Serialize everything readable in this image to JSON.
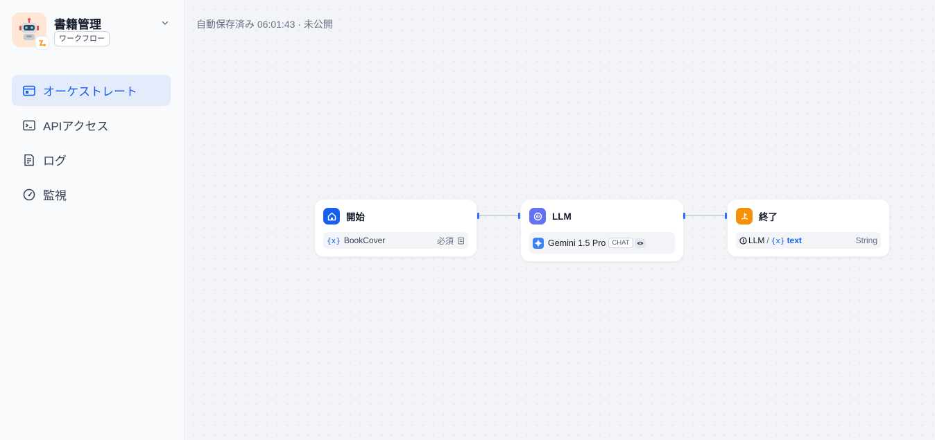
{
  "app": {
    "title": "書籍管理",
    "tag": "ワークフロー"
  },
  "nav": [
    {
      "label": "オーケストレート",
      "icon": "window-icon",
      "active": true
    },
    {
      "label": "APIアクセス",
      "icon": "terminal-icon",
      "active": false
    },
    {
      "label": "ログ",
      "icon": "log-icon",
      "active": false
    },
    {
      "label": "監視",
      "icon": "gauge-icon",
      "active": false
    }
  ],
  "canvas": {
    "status": "自動保存済み 06:01:43 · 未公開"
  },
  "nodes": {
    "start": {
      "title": "開始",
      "var_symbol": "{x}",
      "var_name": "BookCover",
      "required": "必須",
      "color": "#155eef"
    },
    "llm": {
      "title": "LLM",
      "model": "Gemini 1.5 Pro",
      "mode": "CHAT",
      "color": "#6172f3"
    },
    "end": {
      "title": "終了",
      "source": "LLM",
      "var_symbol": "{x}",
      "var_name": "text",
      "type": "String",
      "color": "#f79009"
    }
  }
}
